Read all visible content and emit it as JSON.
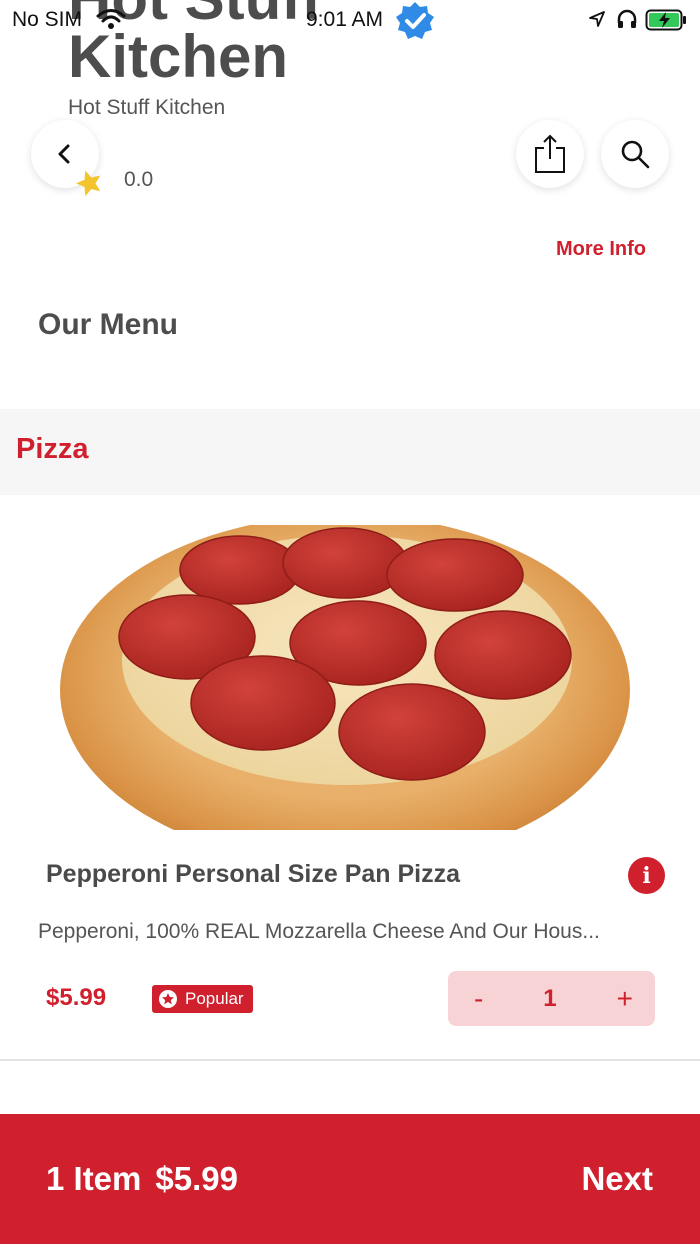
{
  "status_bar": {
    "carrier": "No SIM",
    "time": "9:01 AM"
  },
  "header": {
    "title_line1": "Hot Stuff",
    "title_line2": "Kitchen",
    "subtitle": "Hot Stuff Kitchen",
    "rating": "0.0",
    "more_info": "More Info"
  },
  "menu": {
    "heading": "Our Menu",
    "category": "Pizza",
    "item": {
      "name": "Pepperoni Personal Size Pan Pizza",
      "description": "Pepperoni, 100% REAL Mozzarella Cheese And Our Hous...",
      "price": "$5.99",
      "badge": "Popular",
      "minus": "-",
      "quantity": "1",
      "plus": "+"
    }
  },
  "cart": {
    "items": "1 Item",
    "total": "$5.99",
    "next": "Next"
  },
  "colors": {
    "accent": "#d0202e",
    "stepper_bg": "#f8d3d5",
    "category_bg": "#f6f6f6"
  },
  "icons": [
    "wifi-icon",
    "verified-icon",
    "location-arrow-icon",
    "headphones-icon",
    "battery-icon",
    "back-chevron-icon",
    "share-icon",
    "search-icon",
    "star-icon",
    "info-icon",
    "star-badge-icon"
  ]
}
